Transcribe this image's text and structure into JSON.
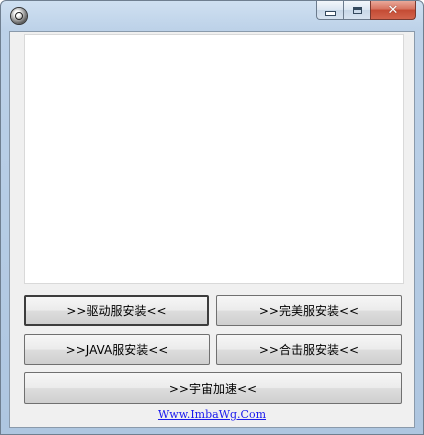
{
  "window": {
    "icon": "ge-logo-icon",
    "controls": {
      "minimize": "minimize-icon",
      "maximize": "maximize-icon",
      "close_glyph": "✕"
    }
  },
  "buttons": {
    "driver_install": ">>驱动服安装<<",
    "perfect_install": ">>完美服安装<<",
    "java_install": ">>JAVA服安装<<",
    "hitbox_install": ">>合击服安装<<",
    "universe_speed": ">>宇宙加速<<"
  },
  "footer": {
    "link_text": "Www.ImbaWg.Com",
    "link_color": "#1a1aee"
  }
}
